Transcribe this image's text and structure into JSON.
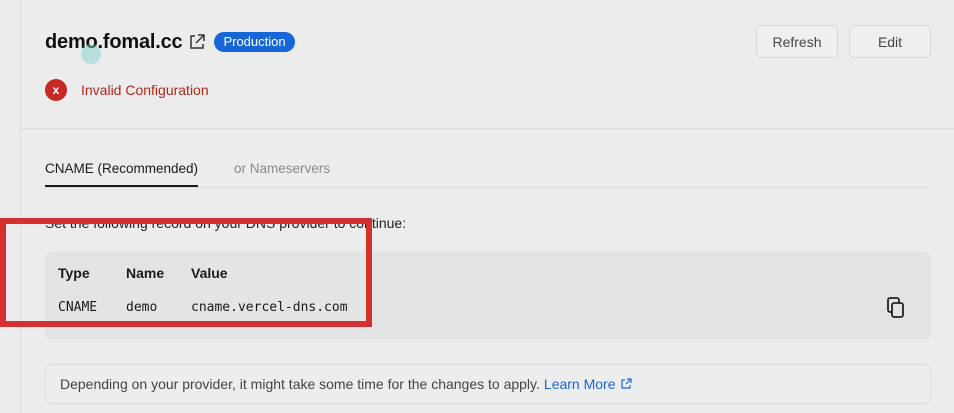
{
  "header": {
    "domain": "demo.fomal.cc",
    "badge": "Production",
    "refresh_label": "Refresh",
    "edit_label": "Edit",
    "status_text": "Invalid Configuration",
    "status_icon": "x"
  },
  "tabs": [
    {
      "label": "CNAME (Recommended)",
      "active": true
    },
    {
      "label": "or Nameservers",
      "active": false
    }
  ],
  "instruction": "Set the following record on your DNS provider to continue:",
  "record": {
    "headers": [
      "Type",
      "Name",
      "Value"
    ],
    "row": [
      "CNAME",
      "demo",
      "cname.vercel-dns.com"
    ]
  },
  "notice": {
    "text": "Depending on your provider, it might take some time for the changes to apply.",
    "link": "Learn More"
  },
  "colors": {
    "badge": "#1666d8",
    "error": "#c62828",
    "highlight": "#d43030",
    "link": "#1666d8"
  },
  "icons": {
    "external_link": "external-link-icon",
    "copy": "copy-icon",
    "status": "error-x-icon"
  }
}
